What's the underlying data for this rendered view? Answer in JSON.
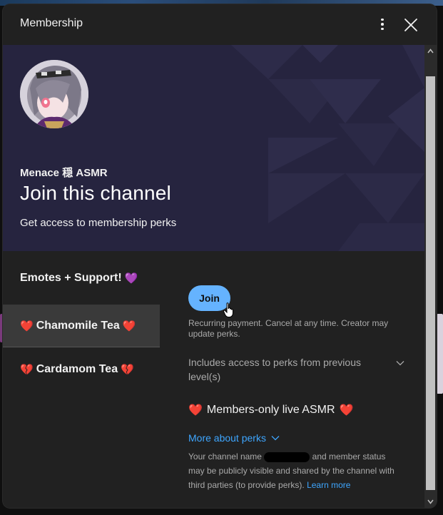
{
  "dialog": {
    "title": "Membership"
  },
  "hero": {
    "channel_name": "Menace 穏 ASMR",
    "heading": "Join this channel",
    "subheading": "Get access to membership perks"
  },
  "tiers": [
    {
      "label": "Emotes + Support!",
      "emoji_after": "💜",
      "selected": false
    },
    {
      "emoji_before": "❤️",
      "label": "Chamomile Tea",
      "emoji_after": "❤️",
      "selected": true
    },
    {
      "emoji_before": "💔",
      "label": "Cardamom Tea",
      "emoji_after": "💔",
      "selected": false
    }
  ],
  "detail": {
    "join_label": "Join",
    "recurring_note": "Recurring payment. Cancel at any time. Creator may update perks.",
    "includes_label": "Includes access to perks from previous level(s)",
    "perk_emoji": "❤️",
    "perk_label": "Members-only live ASMR",
    "more_perks_label": "More about perks",
    "disclaimer_before": "Your channel name",
    "disclaimer_after": "and member status may be publicly visible and shared by the channel with third parties (to provide perks).",
    "learn_more": "Learn more"
  },
  "colors": {
    "dialog_bg": "#212121",
    "hero_bg": "#26243f",
    "join_button": "#65b3ff",
    "link": "#3ea6ff",
    "selected_tier_bg": "#3a3a3a"
  },
  "icons": {
    "more": "vertical-dots-icon",
    "close": "close-x-icon",
    "includes_toggle": "chevron-down-icon",
    "more_perks_toggle": "chevron-down-icon",
    "scroll_up": "triangle-up-icon",
    "scroll_down": "triangle-down-icon"
  }
}
